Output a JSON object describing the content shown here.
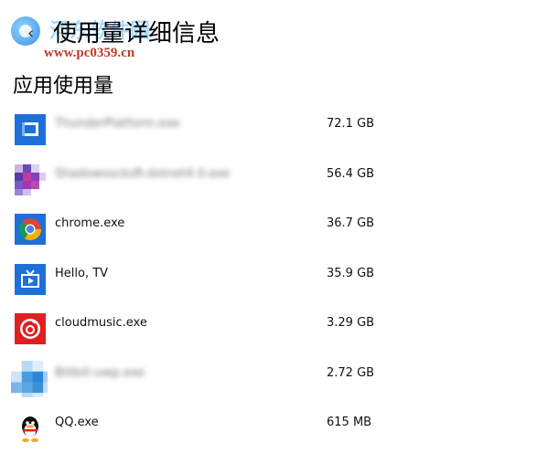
{
  "header": {
    "title": "使用量详细信息",
    "back_glyph": "‹"
  },
  "watermark": {
    "cn": "河东软件园",
    "url": "www.pc0359.cn"
  },
  "section": {
    "title": "应用使用量"
  },
  "apps": [
    {
      "name": "ThunderPlatform.exe",
      "size": "72.1 GB",
      "icon": "thunder-icon",
      "blurred": true
    },
    {
      "name": "ShadowsocksR-dotnet4.0.exe",
      "size": "56.4 GB",
      "icon": "pixelated-app-icon",
      "blurred": true
    },
    {
      "name": "chrome.exe",
      "size": "36.7 GB",
      "icon": "chrome-icon",
      "blurred": false
    },
    {
      "name": "Hello, TV",
      "size": "35.9 GB",
      "icon": "tv-icon",
      "blurred": false
    },
    {
      "name": "cloudmusic.exe",
      "size": "3.29 GB",
      "icon": "cloudmusic-icon",
      "blurred": false
    },
    {
      "name": "Bilibili-uwp.exe",
      "size": "2.72 GB",
      "icon": "pixelated-blue-icon",
      "blurred": true
    },
    {
      "name": "QQ.exe",
      "size": "615 MB",
      "icon": "qq-icon",
      "blurred": false
    }
  ],
  "colors": {
    "accent_blue": "#1e6fd9",
    "cloudmusic_red": "#e02020"
  }
}
